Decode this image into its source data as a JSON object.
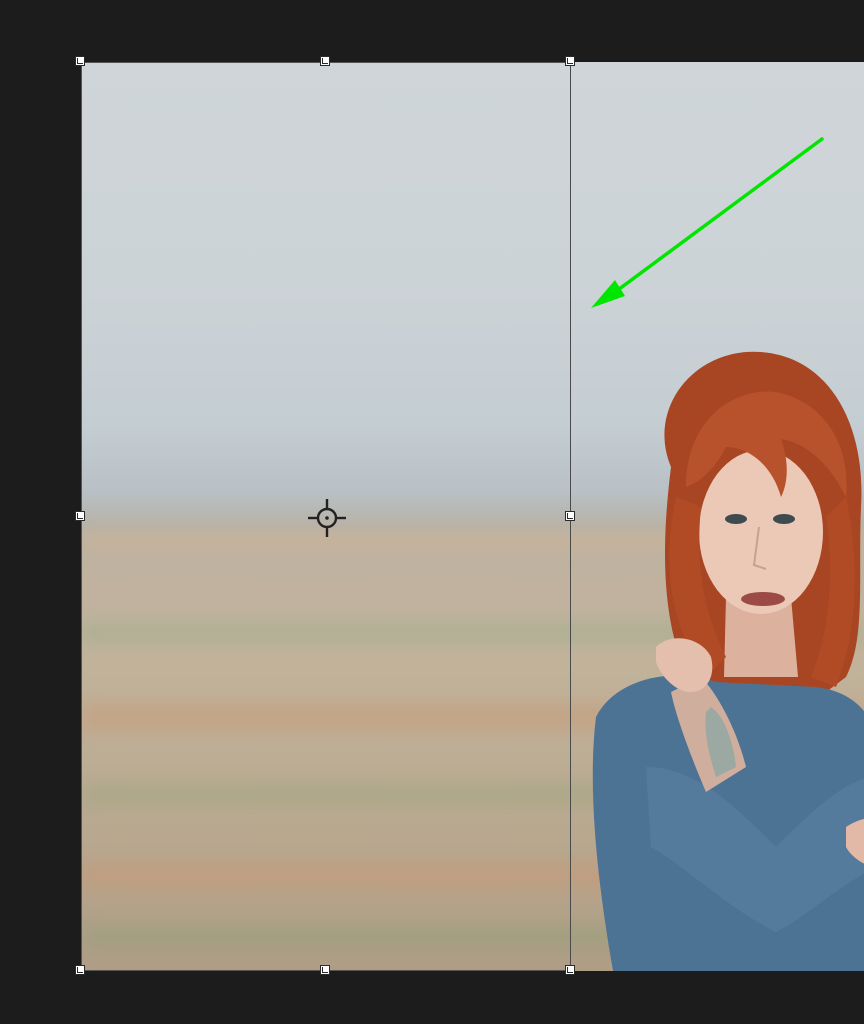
{
  "canvas": {
    "background_color": "#1c1c1c",
    "bounding_box_color": "#4a4a4a",
    "handle_color": "#ffffff",
    "handle_border_color": "#2a2a2a"
  },
  "image": {
    "description_icon": "photo-layer",
    "sky_color": "#cfd5d9",
    "field_color": "#c2b39b",
    "hair_color": "#b2502a",
    "shirt_color": "#4e7394",
    "skin_color": "#e8c3b0"
  },
  "annotation": {
    "arrow_icon": "green-arrow-icon",
    "arrow_color": "#00e600"
  },
  "transform": {
    "reference_point_icon": "crosshair-icon",
    "handles": [
      "top-left",
      "top-center",
      "top-right",
      "middle-left",
      "middle-right",
      "bottom-left",
      "bottom-center",
      "bottom-right"
    ]
  }
}
